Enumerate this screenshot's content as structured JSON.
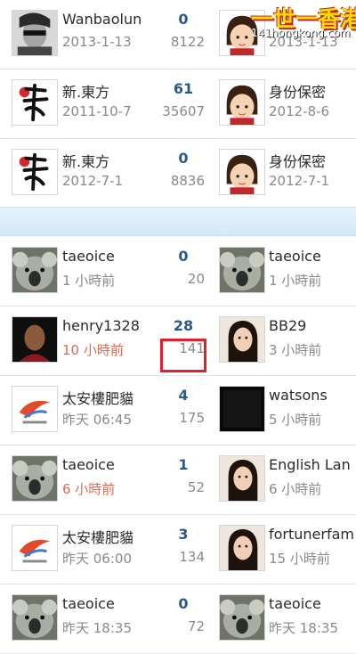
{
  "watermark": {
    "title": "一世一香港",
    "url": "141hongkong.com"
  },
  "rows": [
    {
      "user1": {
        "name": "Wanbaolun",
        "time": "2013-1-13",
        "avatar": "man-sunglasses-avatar"
      },
      "replies": "0",
      "views": "8122",
      "user2": {
        "name": "",
        "time": "2013-1-13",
        "avatar": "cartoon-girl-avatar"
      }
    },
    {
      "user1": {
        "name": "新.東方",
        "time": "2011-10-7",
        "avatar": "calligraphy-logo-avatar"
      },
      "replies": "61",
      "views": "35607",
      "user2": {
        "name": "身份保密",
        "time": "2012-8-6",
        "avatar": "cartoon-girl-avatar"
      }
    },
    {
      "user1": {
        "name": "新.東方",
        "time": "2012-7-1",
        "avatar": "calligraphy-logo-avatar"
      },
      "replies": "0",
      "views": "8836",
      "user2": {
        "name": "身份保密",
        "time": "2012-7-1",
        "avatar": "cartoon-girl-avatar"
      }
    },
    {
      "user1": {
        "name": "taeoice",
        "time": "1 小時前",
        "avatar": "koala-avatar"
      },
      "replies": "0",
      "views": "20",
      "user2": {
        "name": "taeoice",
        "time": "1 小時前",
        "avatar": "koala-avatar"
      }
    },
    {
      "user1": {
        "name": "henry1328",
        "time": "10 小時前",
        "avatar": "bald-man-avatar"
      },
      "replies": "28",
      "views": "141",
      "user2": {
        "name": "BB29",
        "time": "3 小時前",
        "avatar": "woman-portrait-avatar"
      }
    },
    {
      "user1": {
        "name": "太安樓肥貓",
        "time": "昨天 06:45",
        "avatar": "airline-logo-avatar"
      },
      "replies": "4",
      "views": "175",
      "user2": {
        "name": "watsons",
        "time": "5 小時前",
        "avatar": "dark-avatar"
      }
    },
    {
      "user1": {
        "name": "taeoice",
        "time": "6 小時前",
        "avatar": "koala-avatar"
      },
      "replies": "1",
      "views": "52",
      "user2": {
        "name": "English Lan",
        "time": "6 小時前",
        "avatar": "woman-portrait-avatar"
      }
    },
    {
      "user1": {
        "name": "太安樓肥貓",
        "time": "昨天 06:00",
        "avatar": "airline-logo-avatar"
      },
      "replies": "3",
      "views": "134",
      "user2": {
        "name": "fortunerfam",
        "time": "15 小時前",
        "avatar": "woman-portrait-avatar"
      }
    },
    {
      "user1": {
        "name": "taeoice",
        "time": "昨天 18:35",
        "avatar": "koala-avatar"
      },
      "replies": "0",
      "views": "72",
      "user2": {
        "name": "taeoice",
        "time": "昨天 18:35",
        "avatar": "koala-avatar"
      }
    }
  ]
}
